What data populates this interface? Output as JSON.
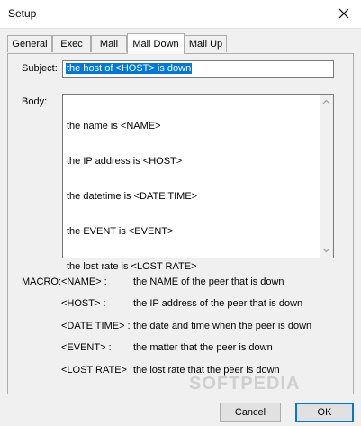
{
  "window": {
    "title": "Setup"
  },
  "tabs": [
    {
      "label": "General"
    },
    {
      "label": "Exec"
    },
    {
      "label": "Mail"
    },
    {
      "label": "Mail Down",
      "active": true
    },
    {
      "label": "Mail Up"
    }
  ],
  "form": {
    "subject_label": "Subject:",
    "subject_value": "the host of <HOST> is down",
    "body_label": "Body:",
    "body_lines": [
      "the name is <NAME>",
      "the IP address is <HOST>",
      "the datetime is <DATE TIME>",
      "the EVENT is <EVENT>",
      "the lost rate is <LOST RATE>"
    ]
  },
  "macros": {
    "heading": "MACRO:",
    "rows": [
      {
        "key": "<NAME> :",
        "desc": "the NAME of the peer that is down"
      },
      {
        "key": "<HOST> :",
        "desc": "the IP address of the peer that is down"
      },
      {
        "key": "<DATE TIME> :",
        "desc": "the date and time when the peer is down"
      },
      {
        "key": "<EVENT> :",
        "desc": "the matter that the peer is down"
      },
      {
        "key": "<LOST RATE> :",
        "desc": "the lost rate that the peer is down"
      }
    ]
  },
  "buttons": {
    "cancel": "Cancel",
    "ok": "OK"
  },
  "watermark": "SOFTPEDIA",
  "colors": {
    "selection": "#0078d7",
    "window_bg": "#f0f0f0"
  }
}
